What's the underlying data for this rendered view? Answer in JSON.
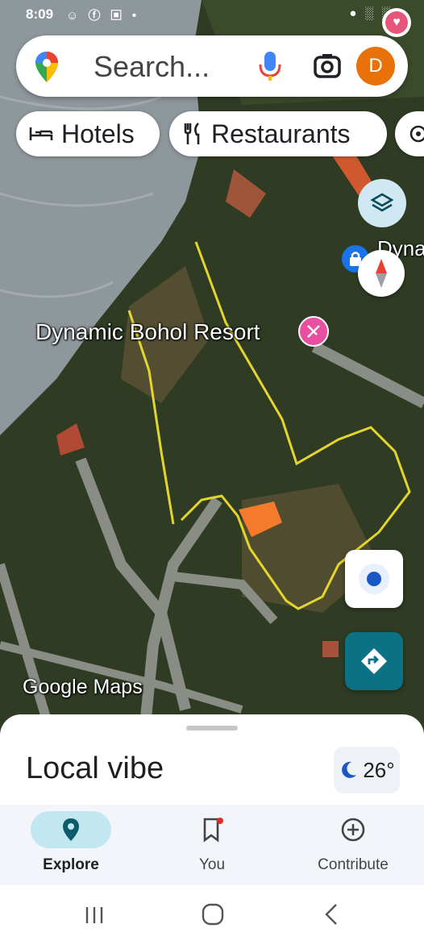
{
  "status_bar": {
    "time": "8:09",
    "left_icons": "☺ ⓕ ▣ •",
    "right_icons": "● ░ ░ ≡"
  },
  "search": {
    "placeholder": "Search...",
    "avatar_initial": "D"
  },
  "chips": [
    {
      "label": "Hotels",
      "icon": "bed-icon"
    },
    {
      "label": "Restaurants",
      "icon": "fork-knife-icon"
    }
  ],
  "map": {
    "place_label": "Dynamic Bohol Resort",
    "partial_label": "Dyna\nve",
    "wordmark": "Google Maps",
    "colors": {
      "water": "#8e979c",
      "vegetation": "#2f3b23",
      "roads": "#8a8d86",
      "trace": "#e3d52a",
      "roof": "#f47a2c",
      "place_pin": "#e84fa0"
    }
  },
  "sheet": {
    "title": "Local vibe",
    "temperature": "26°"
  },
  "bottom_nav": [
    {
      "label": "Explore",
      "icon": "explore-pin-icon",
      "active": true
    },
    {
      "label": "You",
      "icon": "bookmark-icon",
      "active": false
    },
    {
      "label": "Contribute",
      "icon": "add-circle-icon",
      "active": false
    }
  ]
}
